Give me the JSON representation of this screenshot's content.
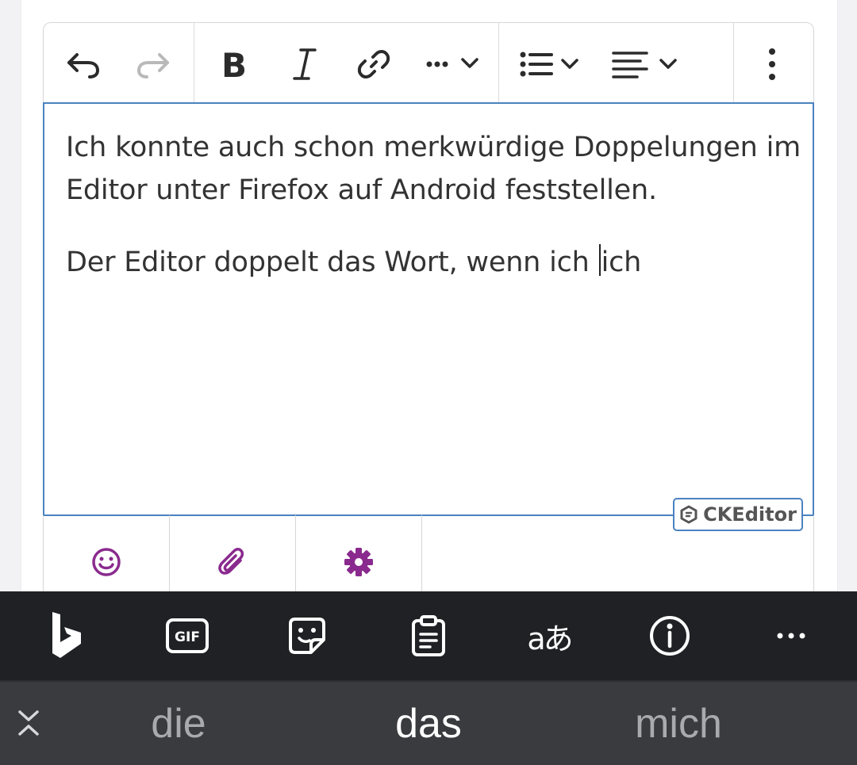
{
  "editor": {
    "toolbar": {
      "items": [
        {
          "name": "undo-icon"
        },
        {
          "name": "redo-icon"
        },
        {
          "name": "bold-icon"
        },
        {
          "name": "italic-icon"
        },
        {
          "name": "link-icon"
        },
        {
          "name": "more-formatting-icon"
        },
        {
          "name": "bulleted-list-icon"
        },
        {
          "name": "align-left-icon"
        },
        {
          "name": "more-vertical-icon"
        }
      ]
    },
    "content": {
      "paragraphs": [
        "Ich konnte auch schon merkwürdige Doppelungen im Editor unter Firefox auf Android feststellen.",
        "Der Editor doppelt das Wort, wenn ich ",
        "ich"
      ]
    },
    "badge": "CKEditor",
    "bottom_buttons": [
      {
        "name": "emoji-icon",
        "color": "#8a2a8e"
      },
      {
        "name": "paperclip-icon",
        "color": "#8a2a8e"
      },
      {
        "name": "gear-icon",
        "color": "#8a2a8e"
      }
    ]
  },
  "keyboard": {
    "toolbar": [
      {
        "name": "bing-icon"
      },
      {
        "name": "gif-icon",
        "label": "GIF"
      },
      {
        "name": "sticker-icon"
      },
      {
        "name": "clipboard-icon"
      },
      {
        "name": "translate-icon",
        "label": "aあ"
      },
      {
        "name": "info-icon"
      },
      {
        "name": "more-horizontal-icon"
      }
    ],
    "suggestions": [
      "die",
      "das",
      "mich"
    ]
  },
  "colors": {
    "accent": "#8a2a8e",
    "focus_border": "#4a82c0",
    "keyboard_bar": "#1f2125",
    "suggestion_bar": "#3a3b3f"
  }
}
